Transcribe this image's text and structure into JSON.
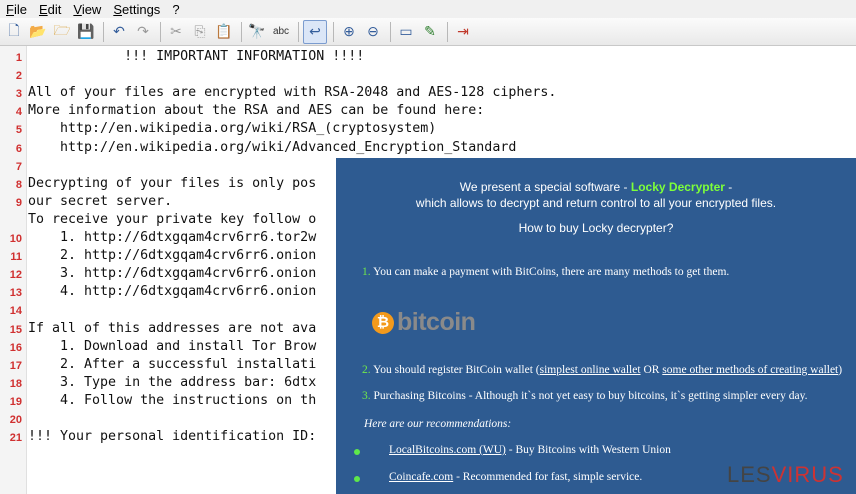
{
  "menu": [
    "File",
    "Edit",
    "View",
    "Settings",
    "?"
  ],
  "toolbar_icons": [
    "new-file-icon",
    "open-folder-icon",
    "open-file-icon",
    "save-icon",
    "undo-icon",
    "redo-icon",
    "cut-icon",
    "copy-icon",
    "paste-icon",
    "find-icon",
    "spellcheck-icon",
    "wordwrap-icon",
    "zoom-in-icon",
    "zoom-out-icon",
    "window-icon",
    "edit-icon",
    "run-icon"
  ],
  "editor": {
    "lines": [
      {
        "n": "1",
        "t": "            !!! IMPORTANT INFORMATION !!!!"
      },
      {
        "n": "2",
        "t": ""
      },
      {
        "n": "3",
        "t": "All of your files are encrypted with RSA-2048 and AES-128 ciphers."
      },
      {
        "n": "4",
        "t": "More information about the RSA and AES can be found here:"
      },
      {
        "n": "5",
        "t": "    http://en.wikipedia.org/wiki/RSA_(cryptosystem)"
      },
      {
        "n": "6",
        "t": "    http://en.wikipedia.org/wiki/Advanced_Encryption_Standard"
      },
      {
        "n": "7",
        "t": ""
      },
      {
        "n": "8",
        "t": "Decrypting of your files is only pos"
      },
      {
        "n": "9",
        "t": "our secret server."
      },
      {
        "n": "",
        "t": "To receive your private key follow o"
      },
      {
        "n": "10",
        "t": "    1. http://6dtxgqam4crv6rr6.tor2w"
      },
      {
        "n": "11",
        "t": "    2. http://6dtxgqam4crv6rr6.onion"
      },
      {
        "n": "12",
        "t": "    3. http://6dtxgqam4crv6rr6.onion"
      },
      {
        "n": "13",
        "t": "    4. http://6dtxgqam4crv6rr6.onion"
      },
      {
        "n": "14",
        "t": ""
      },
      {
        "n": "15",
        "t": "If all of this addresses are not ava"
      },
      {
        "n": "16",
        "t": "    1. Download and install Tor Brow"
      },
      {
        "n": "17",
        "t": "    2. After a successful installati"
      },
      {
        "n": "18",
        "t": "    3. Type in the address bar: 6dtx"
      },
      {
        "n": "19",
        "t": "    4. Follow the instructions on th"
      },
      {
        "n": "20",
        "t": ""
      },
      {
        "n": "21",
        "t": "!!! Your personal identification ID:"
      }
    ]
  },
  "popup": {
    "intro_pre": "We present a special software - ",
    "product": "Locky Decrypter",
    "intro_post": " -",
    "intro_line2": "which allows to decrypt and return control to all your encrypted files.",
    "how_to": "How to buy Locky decrypter?",
    "step1_num": "1.",
    "step1": "You can make a payment with BitCoins, there are many methods to get them.",
    "logo_coin": "₿",
    "logo_word": "bitcoin",
    "step2_num": "2.",
    "step2_pre": "You should register BitCoin wallet (",
    "step2_link1": "simplest online wallet",
    "step2_mid": " OR ",
    "step2_link2": "some other methods of creating wallet",
    "step2_post": ")",
    "step3_num": "3.",
    "step3": "Purchasing Bitcoins - Although it`s not yet easy to buy bitcoins, it`s getting simpler every day.",
    "recommend": "Here are our recommendations:",
    "rec1_link": "LocalBitcoins.com (WU)",
    "rec1_text": " - Buy Bitcoins with Western Union",
    "rec2_link": "Coincafe.com",
    "rec2_text": " - Recommended for fast, simple service."
  },
  "watermark": {
    "ls": "LES",
    "rest": "VIRUS"
  }
}
